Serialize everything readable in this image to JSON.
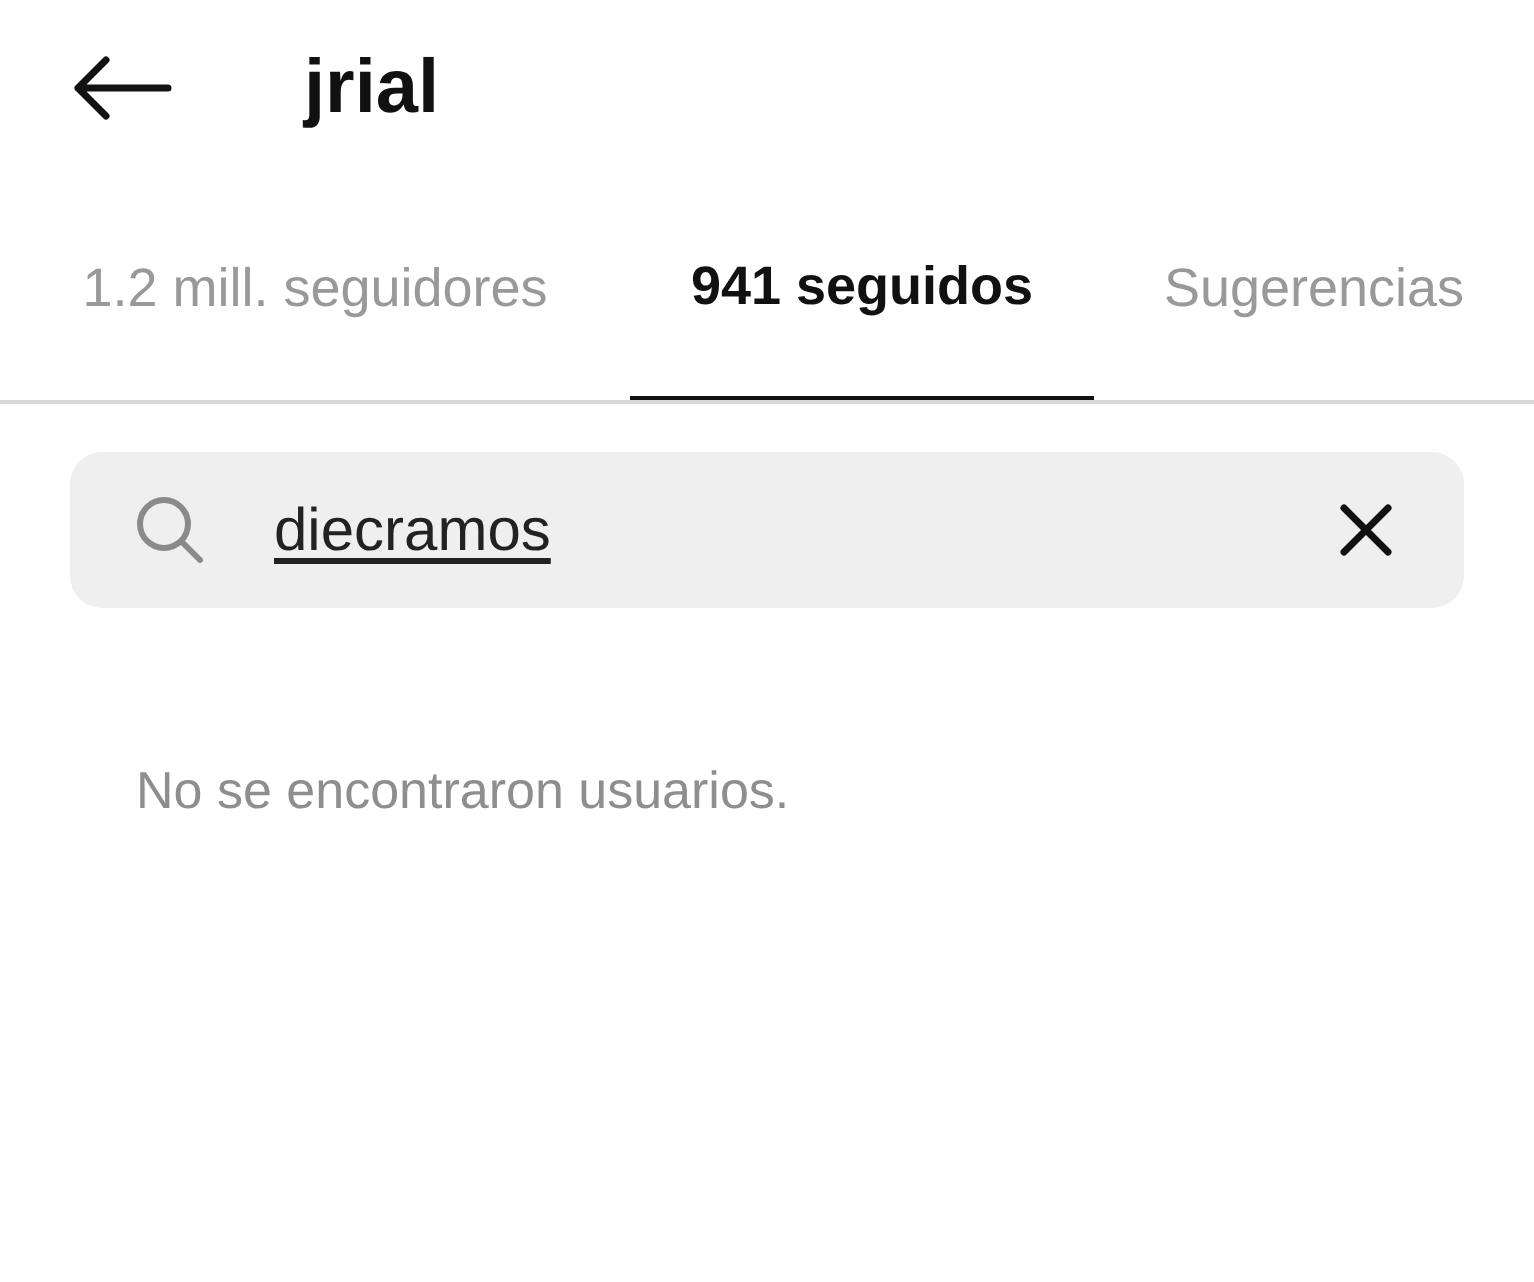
{
  "header": {
    "title": "jrial"
  },
  "tabs": [
    {
      "label": "1.2 mill. seguidores",
      "selected": false
    },
    {
      "label": "941 seguidos",
      "selected": true
    },
    {
      "label": "Sugerencias",
      "selected": false
    }
  ],
  "search": {
    "value": "diecramos"
  },
  "message": "No se encontraron usuarios."
}
